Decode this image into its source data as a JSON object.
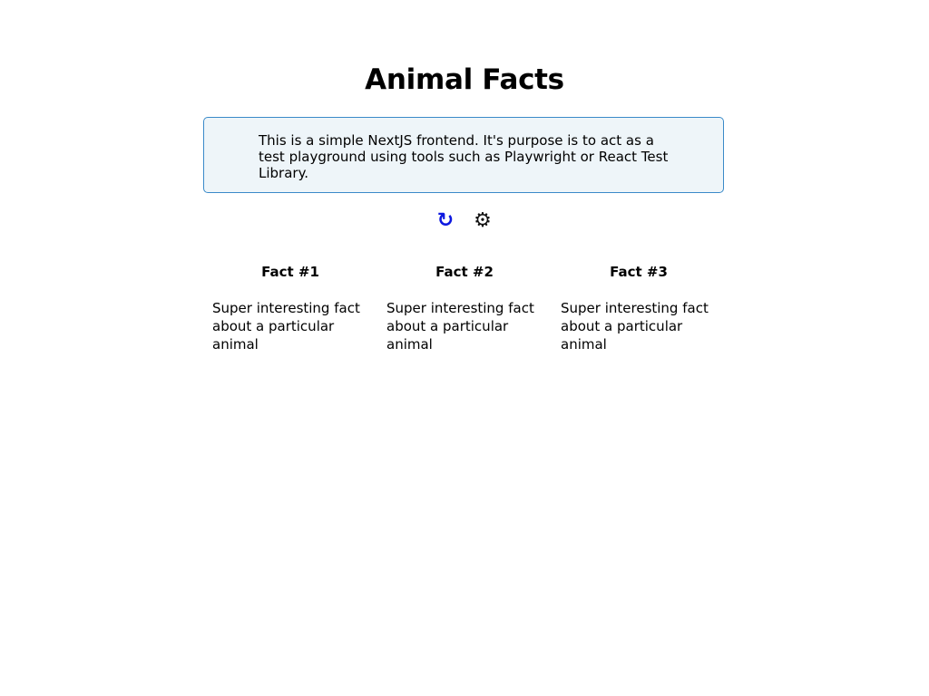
{
  "header": {
    "title": "Animal Facts"
  },
  "info": {
    "text": "This is a simple NextJS frontend. It's purpose is to act as a test playground using tools such as Playwright or React Test Library."
  },
  "controls": {
    "refresh_icon": "↻",
    "settings_icon": "⚙",
    "refresh_color": "#0d18e0"
  },
  "facts": [
    {
      "title": "Fact #1",
      "body": "Super interesting fact about a particular animal"
    },
    {
      "title": "Fact #2",
      "body": "Super interesting fact about a particular animal"
    },
    {
      "title": "Fact #3",
      "body": "Super interesting fact about a particular animal"
    }
  ],
  "colors": {
    "info_border": "#3a8ac9",
    "info_background": "#eef5f9"
  }
}
